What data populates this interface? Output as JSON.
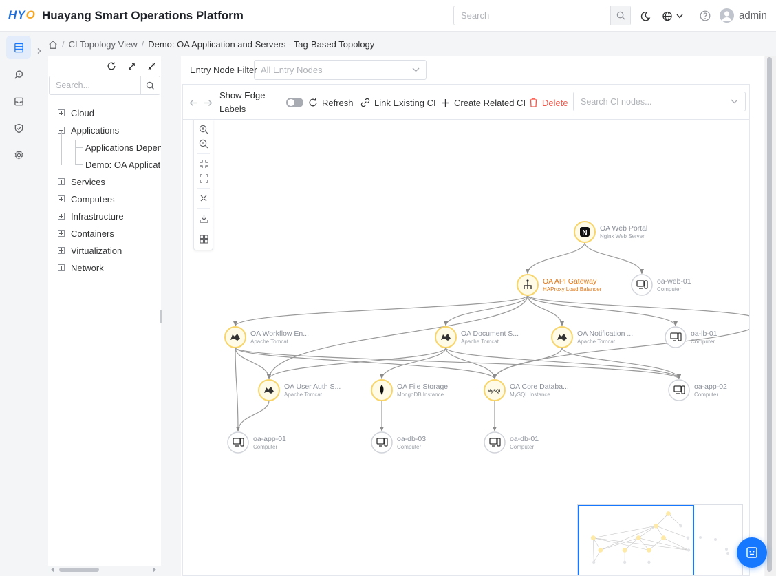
{
  "header": {
    "logo": {
      "h": "H",
      "y": "Y",
      "o": "O"
    },
    "title": "Huayang Smart Operations Platform",
    "search_placeholder": "Search",
    "username": "admin"
  },
  "breadcrumb": [
    "CI Topology View",
    "Demo: OA Application and Servers - Tag-Based Topology"
  ],
  "tree": {
    "search_placeholder": "Search...",
    "nodes": [
      "Cloud",
      "Applications",
      "Services",
      "Computers",
      "Infrastructure",
      "Containers",
      "Virtualization",
      "Network"
    ],
    "children": [
      "Applications Dependency",
      "Demo: OA Application and Servers"
    ]
  },
  "toolbar": {
    "filter_label": "Entry Node Filter",
    "filter_placeholder": "All Entry Nodes",
    "show_edge_labels": [
      "Show Edge",
      "Labels"
    ],
    "refresh": "Refresh",
    "link_existing": "Link Existing CI",
    "create_related": "Create Related CI",
    "delete": "Delete",
    "search_placeholder": "Search CI nodes..."
  },
  "colors": {
    "accent": "#1677ff",
    "highlight": "#e37c1c",
    "node_ring_yellow": "#f8d56b",
    "danger": "#f05a4d"
  },
  "graph": {
    "nodes": [
      {
        "id": "n1",
        "name": "OA Web Portal",
        "type": "Nginx Web Server",
        "kind": "app",
        "icon": "nginx-icon"
      },
      {
        "id": "n2",
        "name": "OA API Gateway",
        "type": "HAProxy Load Balancer",
        "kind": "app",
        "icon": "haproxy-icon",
        "highlight": true
      },
      {
        "id": "n3",
        "name": "oa-web-01",
        "type": "Computer",
        "kind": "computer",
        "icon": "computer-icon"
      },
      {
        "id": "n4",
        "name": "OA Workflow En...",
        "type": "Apache Tomcat",
        "kind": "app",
        "icon": "tomcat-icon"
      },
      {
        "id": "n5",
        "name": "OA Document S...",
        "type": "Apache Tomcat",
        "kind": "app",
        "icon": "tomcat-icon"
      },
      {
        "id": "n6",
        "name": "OA Notification ...",
        "type": "Apache Tomcat",
        "kind": "app",
        "icon": "tomcat-icon"
      },
      {
        "id": "n7",
        "name": "oa-lb-01",
        "type": "Computer",
        "kind": "computer",
        "icon": "computer-icon"
      },
      {
        "id": "n8",
        "name": "OA User Auth S...",
        "type": "Apache Tomcat",
        "kind": "app",
        "icon": "tomcat-icon"
      },
      {
        "id": "n9",
        "name": "OA File Storage",
        "type": "MongoDB Instance",
        "kind": "app",
        "icon": "mongodb-icon"
      },
      {
        "id": "n10",
        "name": "OA Core Databa...",
        "type": "MySQL Instance",
        "kind": "app",
        "icon": "mysql-icon"
      },
      {
        "id": "n11",
        "name": "oa-app-02",
        "type": "Computer",
        "kind": "computer",
        "icon": "computer-icon"
      },
      {
        "id": "n12",
        "name": "oa-app-01",
        "type": "Computer",
        "kind": "computer",
        "icon": "computer-icon"
      },
      {
        "id": "n13",
        "name": "oa-db-03",
        "type": "Computer",
        "kind": "computer",
        "icon": "computer-icon"
      },
      {
        "id": "n14",
        "name": "oa-db-01",
        "type": "Computer",
        "kind": "computer",
        "icon": "computer-icon"
      }
    ],
    "edges": [
      [
        "n1",
        "n2"
      ],
      [
        "n1",
        "n3"
      ],
      [
        "n2",
        "n4"
      ],
      [
        "n2",
        "n5"
      ],
      [
        "n2",
        "n6"
      ],
      [
        "n2",
        "n7"
      ],
      [
        "n2",
        "n8"
      ],
      [
        "n2",
        "offscreen"
      ],
      [
        "n4",
        "n12"
      ],
      [
        "n4",
        "n10"
      ],
      [
        "n4",
        "n11"
      ],
      [
        "n4",
        "n8"
      ],
      [
        "n5",
        "n9"
      ],
      [
        "n5",
        "n10"
      ],
      [
        "n5",
        "n11"
      ],
      [
        "n5",
        "n8"
      ],
      [
        "n6",
        "n10"
      ],
      [
        "n6",
        "n11"
      ],
      [
        "n8",
        "n12"
      ],
      [
        "n9",
        "n13"
      ],
      [
        "n10",
        "n14"
      ],
      [
        "offscreen",
        "n10"
      ]
    ]
  }
}
